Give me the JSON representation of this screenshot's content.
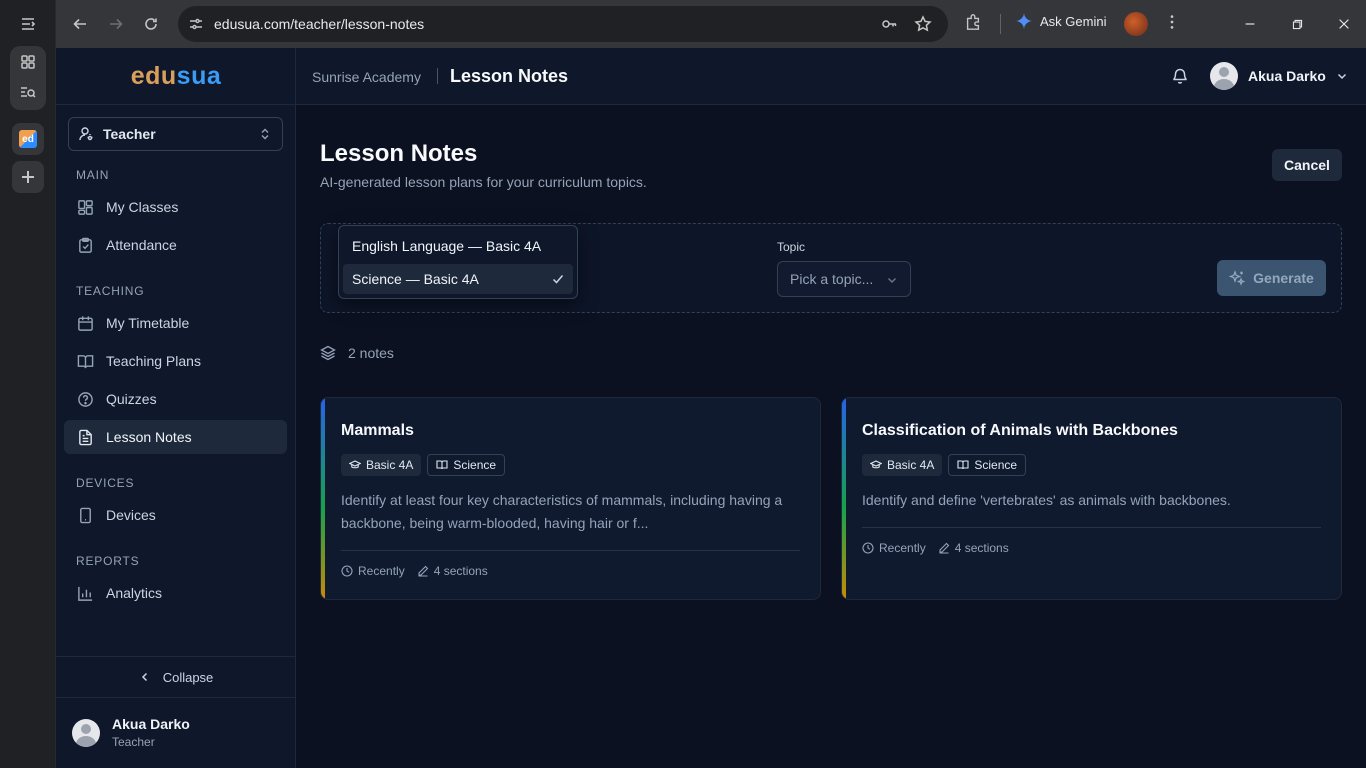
{
  "browser": {
    "url": "edusua.com/teacher/lesson-notes",
    "gemini_label": "Ask Gemini"
  },
  "sidebar": {
    "logo_part1": "edu",
    "logo_part2": "sua",
    "role": "Teacher",
    "sections": [
      {
        "label": "MAIN",
        "items": [
          {
            "label": "My Classes",
            "icon": "grid-icon"
          },
          {
            "label": "Attendance",
            "icon": "clipboard-check-icon"
          }
        ]
      },
      {
        "label": "TEACHING",
        "items": [
          {
            "label": "My Timetable",
            "icon": "calendar-icon"
          },
          {
            "label": "Teaching Plans",
            "icon": "book-open-icon"
          },
          {
            "label": "Quizzes",
            "icon": "help-circle-icon"
          },
          {
            "label": "Lesson Notes",
            "icon": "file-text-icon"
          }
        ]
      },
      {
        "label": "DEVICES",
        "items": [
          {
            "label": "Devices",
            "icon": "tablet-icon"
          }
        ]
      },
      {
        "label": "REPORTS",
        "items": [
          {
            "label": "Analytics",
            "icon": "bar-chart-icon"
          }
        ]
      }
    ],
    "collapse_label": "Collapse",
    "user_name": "Akua Darko",
    "user_role": "Teacher"
  },
  "header": {
    "school": "Sunrise Academy",
    "page": "Lesson Notes",
    "user_name": "Akua Darko"
  },
  "main": {
    "title": "Lesson Notes",
    "subtitle": "AI-generated lesson plans for your curriculum topics.",
    "cancel_label": "Cancel",
    "topic_label": "Topic",
    "topic_placeholder": "Pick a topic...",
    "generate_label": "Generate",
    "class_options": [
      {
        "label": "English Language — Basic 4A",
        "selected": false
      },
      {
        "label": "Science — Basic 4A",
        "selected": true
      }
    ],
    "notes_count": "2 notes",
    "notes": [
      {
        "title": "Mammals",
        "level": "Basic 4A",
        "subject": "Science",
        "description": "Identify at least four key characteristics of mammals, including having a backbone, being warm-blooded, having hair or f...",
        "time": "Recently",
        "sections": "4 sections"
      },
      {
        "title": "Classification of Animals with Backbones",
        "level": "Basic 4A",
        "subject": "Science",
        "description": "Identify and define 'vertebrates' as animals with backbones.",
        "time": "Recently",
        "sections": "4 sections"
      }
    ]
  }
}
